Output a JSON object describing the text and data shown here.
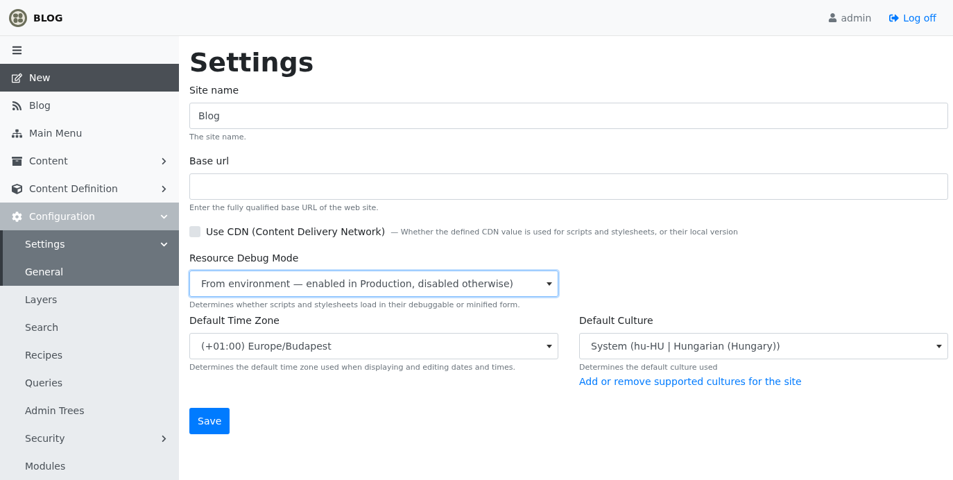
{
  "header": {
    "brand": "BLOG",
    "user": "admin",
    "logoff": "Log off"
  },
  "sidebar": {
    "items": [
      {
        "label": "New",
        "kind": "new",
        "selected": false
      },
      {
        "label": "Blog",
        "kind": "link",
        "selected": false
      },
      {
        "label": "Main Menu",
        "kind": "link",
        "selected": false
      },
      {
        "label": "Content",
        "kind": "group",
        "selected": false,
        "expanded": false
      },
      {
        "label": "Content Definition",
        "kind": "group",
        "selected": false,
        "expanded": false
      },
      {
        "label": "Configuration",
        "kind": "group",
        "selected": true,
        "expanded": true,
        "children": [
          {
            "label": "Settings",
            "kind": "group",
            "selected": true,
            "expanded": true,
            "children": [
              {
                "label": "General",
                "kind": "link",
                "selected": true
              }
            ]
          },
          {
            "label": "Layers",
            "kind": "link",
            "selected": false
          },
          {
            "label": "Search",
            "kind": "link",
            "selected": false
          },
          {
            "label": "Recipes",
            "kind": "link",
            "selected": false
          },
          {
            "label": "Queries",
            "kind": "link",
            "selected": false
          },
          {
            "label": "Admin Trees",
            "kind": "link",
            "selected": false
          },
          {
            "label": "Security",
            "kind": "group",
            "selected": false,
            "expanded": false
          },
          {
            "label": "Modules",
            "kind": "link",
            "selected": false
          }
        ]
      }
    ]
  },
  "page": {
    "title": "Settings",
    "site_name": {
      "label": "Site name",
      "value": "Blog",
      "hint": "The site name."
    },
    "base_url": {
      "label": "Base url",
      "hint": "Enter the fully qualified base URL of the web site."
    },
    "cdn": {
      "label": "Use CDN (Content Delivery Network)",
      "note": "— Whether the defined CDN value is used for scripts and stylesheets, or their local version",
      "checked": false
    },
    "debug_mode": {
      "label": "Resource Debug Mode",
      "value": "From environment — enabled in Production, disabled otherwise)",
      "focused": true,
      "hint": "Determines whether scripts and stylesheets load in their debuggable or minified form."
    },
    "time_zone": {
      "label": "Default Time Zone",
      "value": "(+01:00) Europe/Budapest",
      "focused": false,
      "hint": "Determines the default time zone used when displaying and editing dates and times."
    },
    "culture": {
      "label": "Default Culture",
      "value": "System (hu-HU | Hungarian (Hungary))",
      "focused": false,
      "hint": "Determines the default culture used",
      "link": "Add or remove supported cultures for the site"
    },
    "save": "Save"
  }
}
